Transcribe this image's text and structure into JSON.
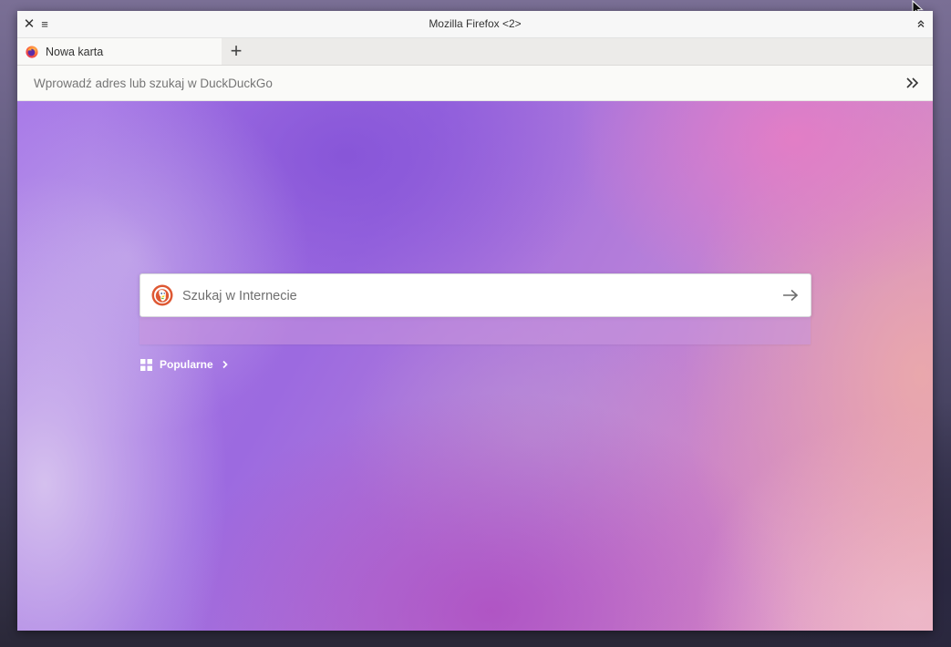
{
  "window": {
    "title": "Mozilla Firefox <2>",
    "close_glyph": "✕",
    "menu_glyph": "≡",
    "collapse_icon": "double-chevron-up-icon"
  },
  "tabs": [
    {
      "label": "Nowa karta",
      "icon": "firefox-icon",
      "active": true
    }
  ],
  "new_tab_glyph": "+",
  "address_bar": {
    "placeholder": "Wprowadź adres lub szukaj w DuckDuckGo",
    "value": "",
    "overflow_icon": "double-chevron-right-icon"
  },
  "new_tab_page": {
    "search": {
      "placeholder": "Szukaj w Internecie",
      "value": "",
      "engine_icon": "duckduckgo-icon",
      "submit_icon": "arrow-right-icon"
    },
    "popular": {
      "label": "Popularne",
      "icon": "grid-icon",
      "expand_icon": "chevron-right-icon"
    }
  },
  "colors": {
    "accent_gradient": [
      "#9c6ae0",
      "#d78bc6",
      "#e9a1b6"
    ],
    "window_chrome": "#f6f5f4",
    "text": "#333333"
  }
}
